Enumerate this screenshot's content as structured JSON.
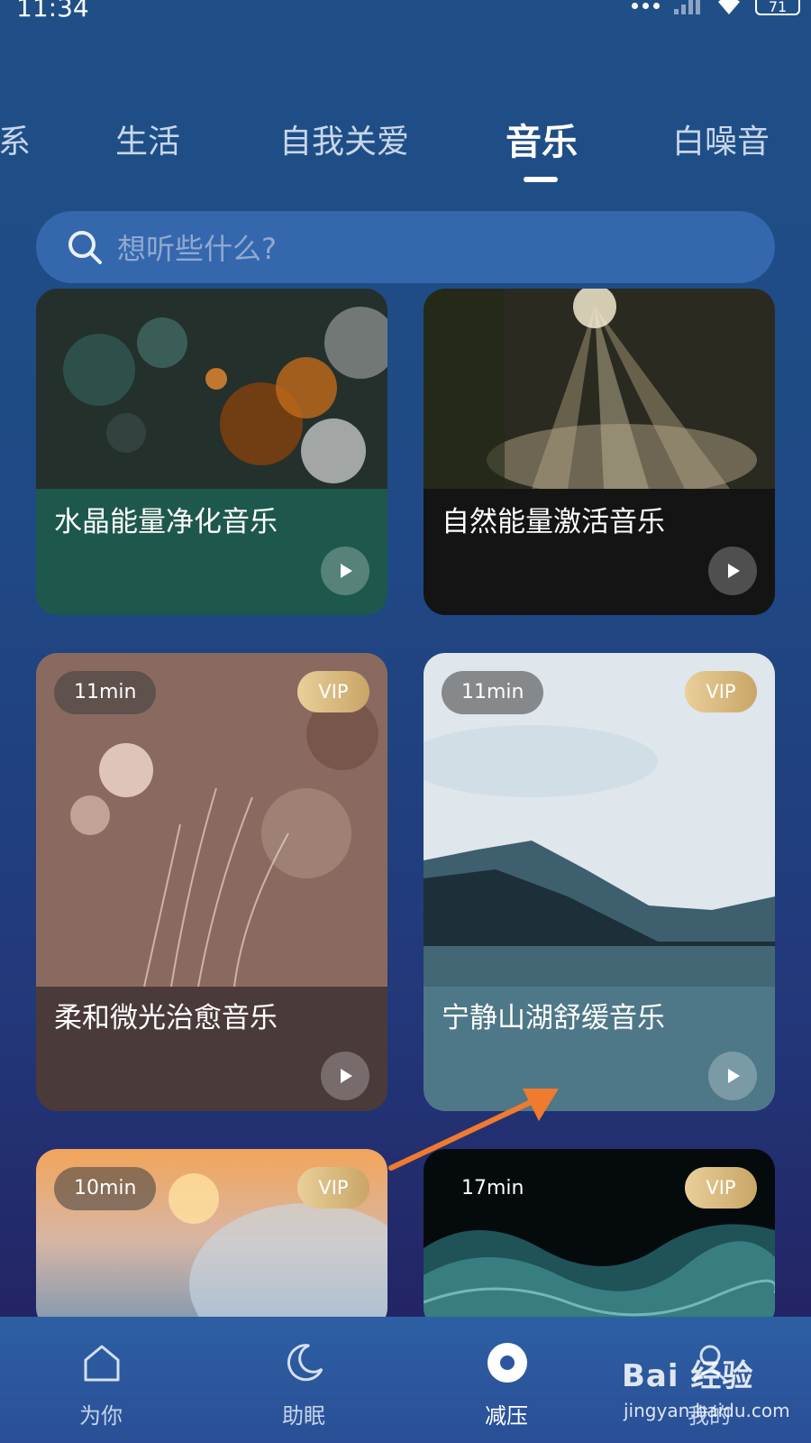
{
  "status_bar": {
    "time": "11:34",
    "battery": "71"
  },
  "tabs": [
    {
      "label": "系",
      "active": false
    },
    {
      "label": "生活",
      "active": false
    },
    {
      "label": "自我关爱",
      "active": false
    },
    {
      "label": "音乐",
      "active": true
    },
    {
      "label": "白噪音",
      "active": false
    }
  ],
  "search": {
    "placeholder": "想听些什么?"
  },
  "cards": [
    {
      "title": "水晶能量净化音乐",
      "duration": "",
      "vip": ""
    },
    {
      "title": "自然能量激活音乐",
      "duration": "",
      "vip": ""
    },
    {
      "title": "柔和微光治愈音乐",
      "duration": "11min",
      "vip": "VIP"
    },
    {
      "title": "宁静山湖舒缓音乐",
      "duration": "11min",
      "vip": "VIP"
    },
    {
      "title": "",
      "duration": "10min",
      "vip": "VIP"
    },
    {
      "title": "",
      "duration": "17min",
      "vip": "VIP"
    }
  ],
  "bottom_nav": [
    {
      "label": "为你",
      "icon": "home-icon",
      "active": false
    },
    {
      "label": "助眠",
      "icon": "moon-icon",
      "active": false
    },
    {
      "label": "减压",
      "icon": "relax-icon",
      "active": true
    },
    {
      "label": "我的",
      "icon": "profile-icon",
      "active": false
    }
  ],
  "watermark": {
    "brand": "Bai 经验",
    "url": "jingyan.baidu.com"
  },
  "colors": {
    "background": "#1f4f86",
    "search_bg": "#3567ad",
    "vip_gold": "#d9bb80",
    "annotation_arrow": "#f07a2e"
  }
}
